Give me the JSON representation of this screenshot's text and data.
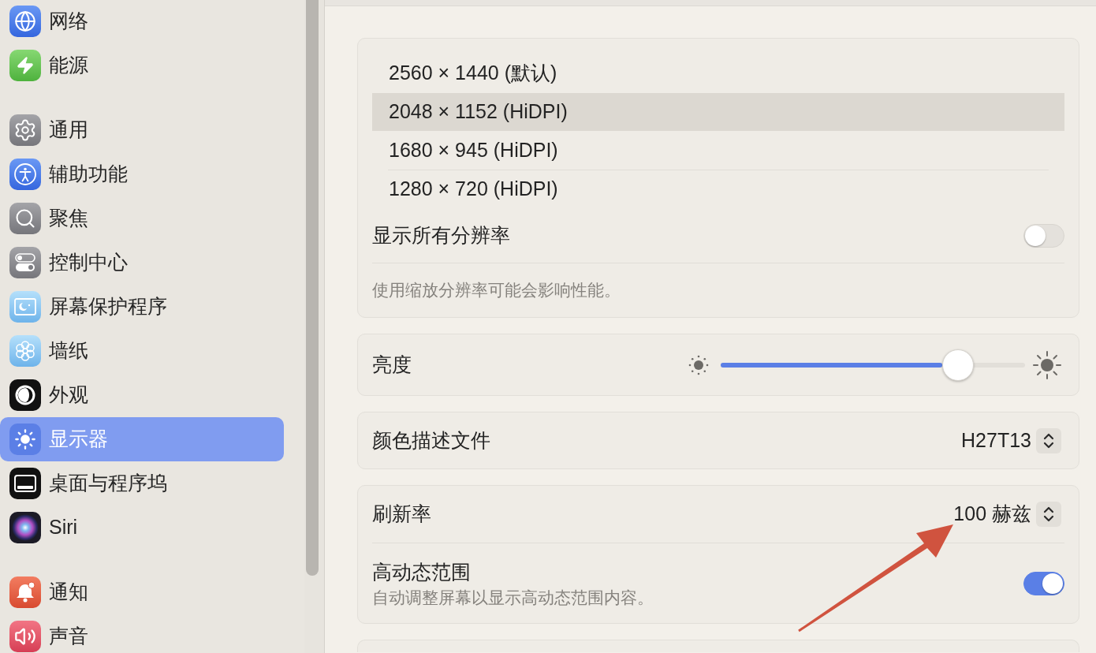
{
  "sidebar": {
    "groups": [
      {
        "items": [
          {
            "label": "网络",
            "selected": false
          },
          {
            "label": "能源",
            "selected": false
          }
        ]
      },
      {
        "items": [
          {
            "label": "通用",
            "selected": false
          },
          {
            "label": "辅助功能",
            "selected": false
          },
          {
            "label": "聚焦",
            "selected": false
          },
          {
            "label": "控制中心",
            "selected": false
          },
          {
            "label": "屏幕保护程序",
            "selected": false
          },
          {
            "label": "墙纸",
            "selected": false
          },
          {
            "label": "外观",
            "selected": false
          },
          {
            "label": "显示器",
            "selected": true
          },
          {
            "label": "桌面与程序坞",
            "selected": false
          },
          {
            "label": "Siri",
            "selected": false
          }
        ]
      },
      {
        "items": [
          {
            "label": "通知",
            "selected": false
          },
          {
            "label": "声音",
            "selected": false
          }
        ]
      }
    ]
  },
  "resolutions": {
    "options": [
      {
        "label": "2560 × 1440 (默认)",
        "selected": false
      },
      {
        "label": "2048 × 1152 (HiDPI)",
        "selected": true
      },
      {
        "label": "1680 × 945 (HiDPI)",
        "selected": false
      },
      {
        "label": "1280 × 720 (HiDPI)",
        "selected": false
      }
    ],
    "show_all": {
      "label": "显示所有分辨率",
      "on": false
    },
    "note": "使用缩放分辨率可能会影响性能。"
  },
  "brightness": {
    "label": "亮度",
    "level": 0.78
  },
  "color_profile": {
    "label": "颜色描述文件",
    "value": "H27T13"
  },
  "refresh_rate": {
    "label": "刷新率",
    "value": "100 赫兹"
  },
  "hdr": {
    "label": "高动态范围",
    "description": "自动调整屏幕以显示高动态范围内容。",
    "on": true
  },
  "annotations": [
    {
      "kind": "arrow"
    }
  ]
}
